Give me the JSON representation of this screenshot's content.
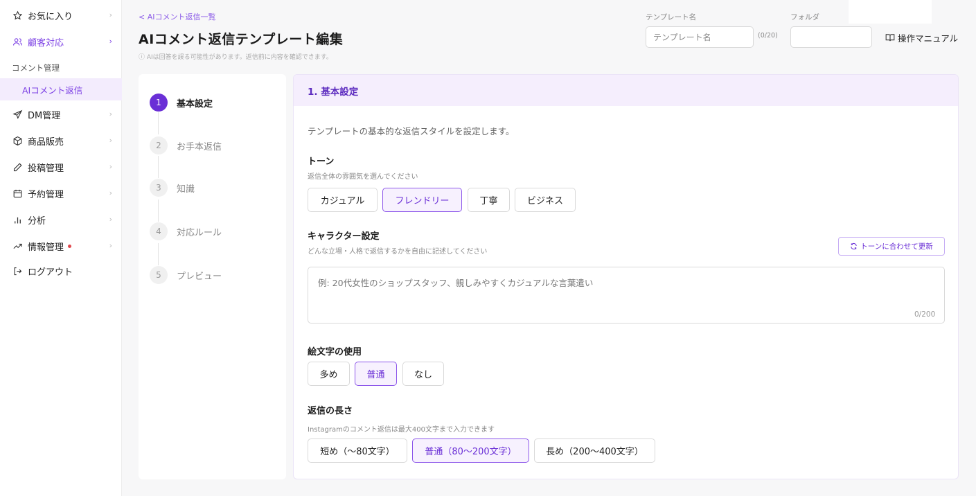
{
  "sidebar": {
    "items": [
      {
        "label": "お気に入り",
        "icon": "star-icon"
      },
      {
        "label": "顧客対応",
        "icon": "users-icon"
      },
      {
        "label": "DM管理",
        "icon": "send-icon"
      },
      {
        "label": "商品販売",
        "icon": "box-icon"
      },
      {
        "label": "投稿管理",
        "icon": "pen-icon"
      },
      {
        "label": "予約管理",
        "icon": "calendar-icon"
      },
      {
        "label": "分析",
        "icon": "bar-chart-icon"
      },
      {
        "label": "情報管理",
        "icon": "trend-icon"
      },
      {
        "label": "ログアウト",
        "icon": "logout-icon"
      }
    ],
    "section_label": "コメント管理",
    "sub_item": "AIコメント返信"
  },
  "header": {
    "breadcrumb": "< AIコメント返信一覧",
    "title": "AIコメント返信テンプレート編集",
    "notice": "ⓘ AIは回答を誤る可能性があります。返信前に内容を確認できます。",
    "template_name_label": "テンプレート名",
    "template_name_placeholder": "テンプレート名",
    "template_name_value": "",
    "template_counter": "(0/20)",
    "folder_label": "フォルダ",
    "folder_value": "",
    "manual": "操作マニュアル"
  },
  "steps": [
    {
      "num": "1",
      "label": "基本設定"
    },
    {
      "num": "2",
      "label": "お手本返信"
    },
    {
      "num": "3",
      "label": "知識"
    },
    {
      "num": "4",
      "label": "対応ルール"
    },
    {
      "num": "5",
      "label": "プレビュー"
    }
  ],
  "current_step": 1,
  "section": {
    "title": "1. 基本設定",
    "description": "テンプレートの基本的な返信スタイルを設定します。"
  },
  "tone": {
    "title": "トーン",
    "sub": "返信全体の雰囲気を選んでください",
    "options": [
      "カジュアル",
      "フレンドリー",
      "丁寧",
      "ビジネス"
    ],
    "selected": "フレンドリー"
  },
  "character": {
    "title": "キャラクター設定",
    "sub": "どんな立場・人格で返信するかを自由に記述してください",
    "update_button": "トーンに合わせて更新",
    "placeholder": "例: 20代女性のショップスタッフ、親しみやすくカジュアルな言葉遣い",
    "value": "",
    "counter": "0/200"
  },
  "emoji": {
    "title": "絵文字の使用",
    "options": [
      "多め",
      "普通",
      "なし"
    ],
    "selected": "普通"
  },
  "length": {
    "title": "返信の長さ",
    "sub": "Instagramのコメント返信は最大400文字まで入力できます",
    "options": [
      "短め（〜80文字）",
      "普通（80〜200文字）",
      "長め（200〜400文字）"
    ],
    "selected": "普通（80〜200文字）"
  },
  "colors": {
    "accent": "#6a2fd6",
    "accent_light": "#f5eefd",
    "alert": "#e0474c"
  }
}
